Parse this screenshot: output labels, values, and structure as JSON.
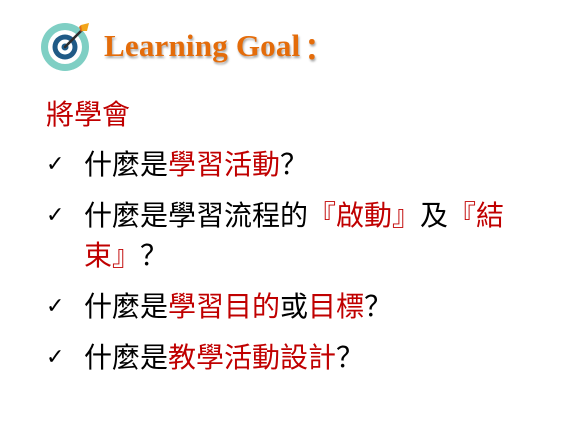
{
  "header": {
    "title": "Learning Goal",
    "colon": "："
  },
  "subtitle": "將學會",
  "check_glyph": "✓",
  "items": [
    {
      "segments": [
        {
          "text": "什麼是",
          "highlight": false
        },
        {
          "text": "學習活動",
          "highlight": true
        },
        {
          "text": "？",
          "highlight": false
        }
      ]
    },
    {
      "segments": [
        {
          "text": "什麼是學習流程的",
          "highlight": false
        },
        {
          "text": "『啟動』",
          "highlight": true
        },
        {
          "text": "及",
          "highlight": false
        },
        {
          "text": "『結束』",
          "highlight": true
        },
        {
          "text": "？",
          "highlight": false
        }
      ]
    },
    {
      "segments": [
        {
          "text": "什麼是",
          "highlight": false
        },
        {
          "text": "學習目的",
          "highlight": true
        },
        {
          "text": "或",
          "highlight": false
        },
        {
          "text": "目標",
          "highlight": true
        },
        {
          "text": "？",
          "highlight": false
        }
      ]
    },
    {
      "segments": [
        {
          "text": "什麼是",
          "highlight": false
        },
        {
          "text": "教學活動設計",
          "highlight": true
        },
        {
          "text": "？",
          "highlight": false
        }
      ]
    }
  ],
  "colors": {
    "title": "#e46c0a",
    "highlight": "#c00000",
    "text": "#000000"
  }
}
